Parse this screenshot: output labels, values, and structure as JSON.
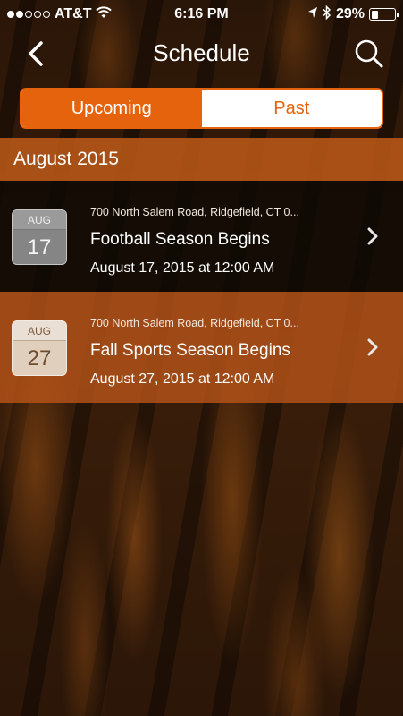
{
  "status_bar": {
    "carrier": "AT&T",
    "time": "6:16 PM",
    "battery_percent": "29%",
    "battery_level": 0.29,
    "signal_bars_filled": 2,
    "signal_bars_total": 5,
    "icons": [
      "wifi-icon",
      "location-arrow-icon",
      "bluetooth-icon",
      "battery-icon"
    ]
  },
  "nav": {
    "title": "Schedule",
    "back_icon": "chevron-left-icon",
    "search_icon": "search-icon"
  },
  "tabs": {
    "upcoming_label": "Upcoming",
    "past_label": "Past",
    "selected": "Upcoming"
  },
  "colors": {
    "accent": "#e5630d",
    "month_header": "#be5a19"
  },
  "schedule": {
    "month_label": "August 2015",
    "events": [
      {
        "badge_month": "AUG",
        "badge_day": "17",
        "location": "700 North Salem Road, Ridgefield, CT 0...",
        "title": "Football Season Begins",
        "datetime": "August 17, 2015 at 12:00 AM"
      },
      {
        "badge_month": "AUG",
        "badge_day": "27",
        "location": "700 North Salem Road, Ridgefield, CT 0...",
        "title": "Fall Sports Season Begins",
        "datetime": "August 27, 2015 at 12:00 AM"
      }
    ]
  }
}
